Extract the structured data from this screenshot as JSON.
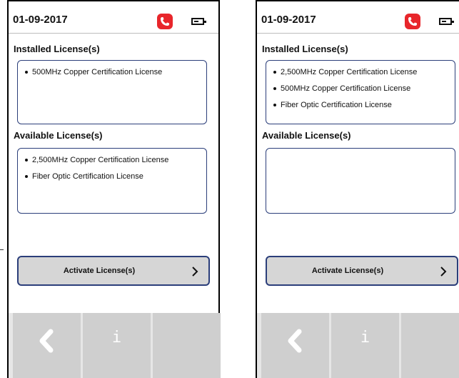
{
  "panels": [
    {
      "header": {
        "date": "01-09-2017",
        "phone_icon": "phone-icon",
        "battery_icon": "battery-icon"
      },
      "installed": {
        "title": "Installed License(s)",
        "items": [
          "500MHz Copper Certification License"
        ]
      },
      "available": {
        "title": "Available License(s)",
        "items": [
          "2,500MHz Copper Certification License",
          "Fiber Optic Certification License"
        ]
      },
      "activate_button": {
        "label": "Activate License(s)",
        "icon": "chevron-right-icon"
      },
      "footer": {
        "back_icon": "chevron-left-icon",
        "info_label": "i"
      }
    },
    {
      "header": {
        "date": "01-09-2017",
        "phone_icon": "phone-icon",
        "battery_icon": "battery-icon"
      },
      "installed": {
        "title": "Installed License(s)",
        "items": [
          "2,500MHz Copper Certification License",
          "500MHz Copper Certification License",
          "Fiber Optic Certification License"
        ]
      },
      "available": {
        "title": "Available License(s)",
        "items": []
      },
      "activate_button": {
        "label": "Activate License(s)",
        "icon": "chevron-right-icon"
      },
      "footer": {
        "back_icon": "chevron-left-icon",
        "info_label": "i"
      }
    }
  ],
  "colors": {
    "accent_border": "#2b3e7a",
    "phone_red": "#e8262b",
    "button_gray": "#d6d6d6",
    "footer_gray": "#cfcfcf"
  }
}
